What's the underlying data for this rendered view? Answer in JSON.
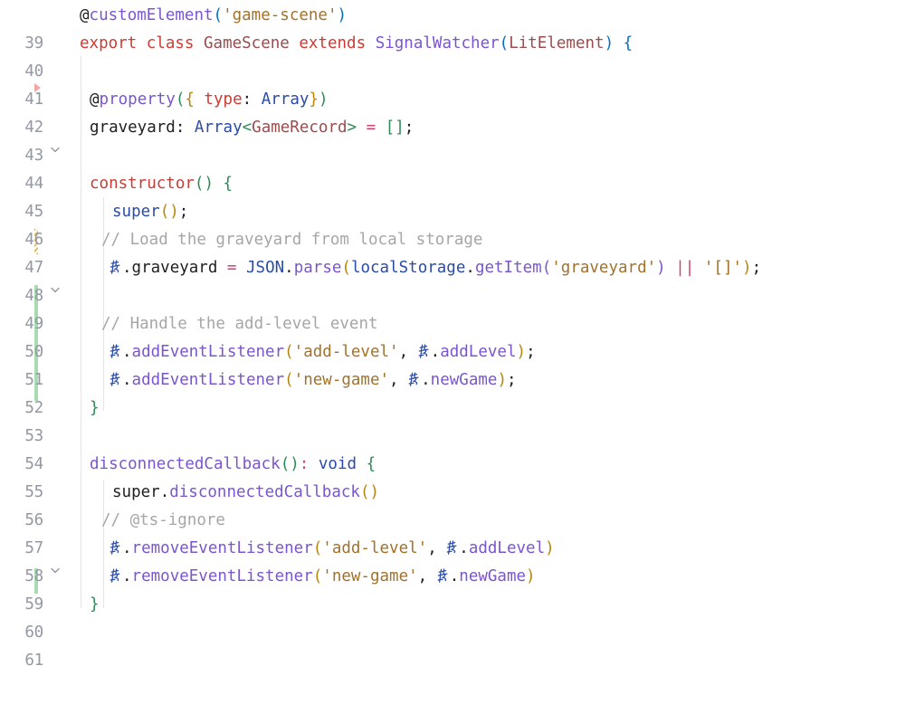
{
  "editor": {
    "language": "typescript",
    "first_line": 39,
    "last_line": 61,
    "background": "#ffffff",
    "gutter_color": "#9398a3",
    "this_keyword_glyph": "this-ligature-icon",
    "colors": {
      "keyword": "#cc3c34",
      "class_name": "#9b4d4d",
      "function": "#7b55cf",
      "variable": "#2a4ca8",
      "string": "#a2722c",
      "comment": "#a6a6a6",
      "operator": "#d43f6e",
      "bracket_blue": "#0a6ebd",
      "bracket_gold": "#b8860b",
      "bracket_green": "#2e8b57",
      "bracket_purple": "#7b55cf",
      "diff_added": "#a8dcb0",
      "diff_modified": "#d9b45a",
      "breakpoint_hint": "#f1a7a7"
    }
  },
  "gutter": {
    "line_numbers": [
      "39",
      "40",
      "41",
      "42",
      "43",
      "44",
      "45",
      "46",
      "47",
      "48",
      "49",
      "50",
      "51",
      "52",
      "53",
      "54",
      "55",
      "56",
      "57",
      "58",
      "59",
      "60",
      "61"
    ],
    "fold_chevrons": [
      40,
      45,
      55
    ],
    "fold_icon": "chevron-down-icon",
    "markers": [
      {
        "name": "breakpoint-hint-marker",
        "line": 42,
        "type": "triangle"
      },
      {
        "name": "diff-modified-marker",
        "start": 47,
        "end": 47,
        "type": "modified"
      },
      {
        "name": "diff-added-marker",
        "start": 49,
        "end": 53,
        "type": "added"
      },
      {
        "name": "diff-added-marker",
        "start": 59,
        "end": 59,
        "type": "added"
      }
    ]
  },
  "code_lines": [
    {
      "n": "39",
      "text": "@customElement('game-scene')"
    },
    {
      "n": "40",
      "text": "export class GameScene extends SignalWatcher(LitElement) {"
    },
    {
      "n": "41",
      "text": ""
    },
    {
      "n": "42",
      "text": "  @property({ type: Array})"
    },
    {
      "n": "43",
      "text": "  graveyard: Array<GameRecord> = [];"
    },
    {
      "n": "44",
      "text": ""
    },
    {
      "n": "45",
      "text": "  constructor() {"
    },
    {
      "n": "46",
      "text": "    super();"
    },
    {
      "n": "47",
      "text": "   // Load the graveyard from local storage"
    },
    {
      "n": "48",
      "text": "    this.graveyard = JSON.parse(localStorage.getItem('graveyard') || '[]');"
    },
    {
      "n": "49",
      "text": ""
    },
    {
      "n": "50",
      "text": "   // Handle the add-level event"
    },
    {
      "n": "51",
      "text": "    this.addEventListener('add-level', this.addLevel);"
    },
    {
      "n": "52",
      "text": "    this.addEventListener('new-game', this.newGame);"
    },
    {
      "n": "53",
      "text": "  }"
    },
    {
      "n": "54",
      "text": ""
    },
    {
      "n": "55",
      "text": "  disconnectedCallback(): void {"
    },
    {
      "n": "56",
      "text": "    super.disconnectedCallback()"
    },
    {
      "n": "57",
      "text": "   // @ts-ignore"
    },
    {
      "n": "58",
      "text": "    this.removeEventListener('add-level', this.addLevel)"
    },
    {
      "n": "59",
      "text": "    this.removeEventListener('new-game', this.newGame)"
    },
    {
      "n": "60",
      "text": "  }"
    },
    {
      "n": "61",
      "text": ""
    }
  ],
  "tokens": {
    "at": "@",
    "customElement": "customElement",
    "game_scene_string": "'game-scene'",
    "export": "export",
    "class": "class",
    "GameScene": "GameScene",
    "extends": "extends",
    "SignalWatcher": "SignalWatcher",
    "LitElement": "LitElement",
    "property": "property",
    "type": "type",
    "Array": "Array",
    "graveyard": "graveyard",
    "GameRecord": "GameRecord",
    "constructor": "constructor",
    "super": "super",
    "comment_load": "// Load the graveyard from local storage",
    "comment_handle": "// Handle the add-level event",
    "comment_ts_ignore": "// @ts-ignore",
    "JSON": "JSON",
    "parse": "parse",
    "localStorage": "localStorage",
    "getItem": "getItem",
    "graveyard_string": "'graveyard'",
    "empty_array_string": "'[]'",
    "or_operator": "||",
    "addEventListener": "addEventListener",
    "removeEventListener": "removeEventListener",
    "add_level_string": "'add-level'",
    "new_game_string": "'new-game'",
    "addLevel": "addLevel",
    "newGame": "newGame",
    "disconnectedCallback": "disconnectedCallback",
    "void": "void"
  }
}
